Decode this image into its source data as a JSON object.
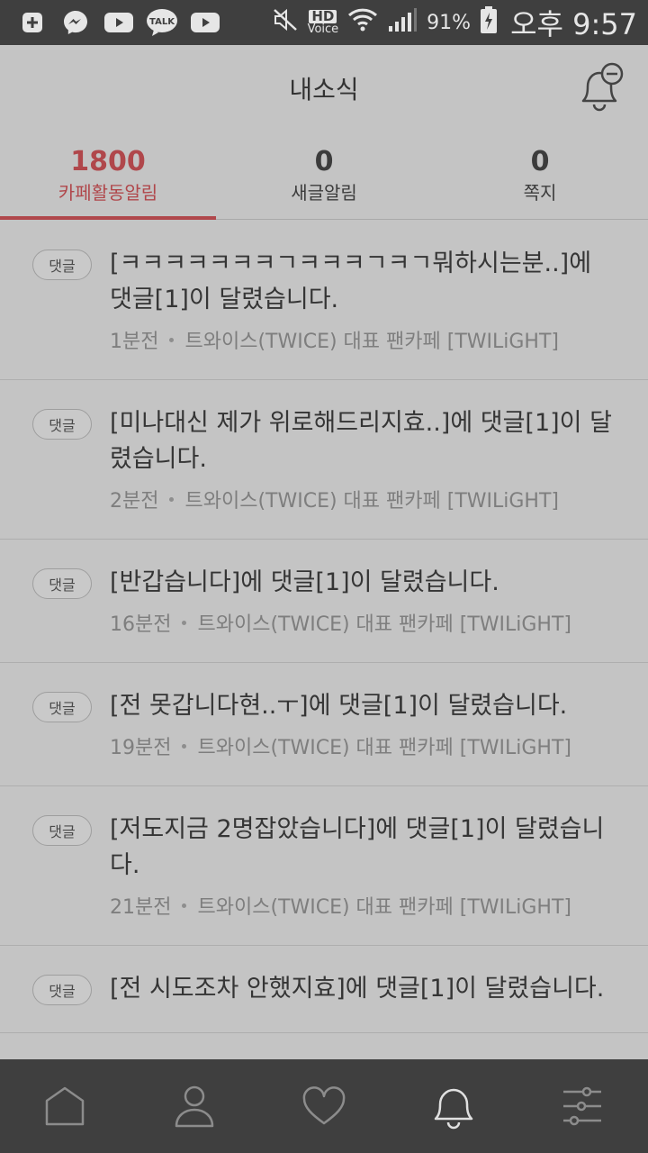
{
  "status_bar": {
    "apps": [
      "plus-square-icon",
      "messenger-icon",
      "youtube-icon",
      "kakaotalk-icon",
      "youtube-icon"
    ],
    "talk_label": "TALK",
    "hd_label": "HD",
    "voice_label": "Voice",
    "battery_percent": "91%",
    "time": "오후 9:57"
  },
  "header": {
    "title": "내소식"
  },
  "tabs": [
    {
      "count": "1800",
      "label": "카페활동알림",
      "active": true
    },
    {
      "count": "0",
      "label": "새글알림",
      "active": false
    },
    {
      "count": "0",
      "label": "쪽지",
      "active": false
    }
  ],
  "notifications": [
    {
      "badge": "댓글",
      "text": "[ㅋㅋㅋㅋㅋㅋㅋㄱㅋㅋㅋㄱㅋㄱ뭐하시는분..]에 댓글[1]이 달렸습니다.",
      "time": "1분전",
      "cafe": "트와이스(TWICE) 대표 팬카페 [TWILiGHT]"
    },
    {
      "badge": "댓글",
      "text": "[미나대신 제가 위로해드리지효..]에 댓글[1]이 달렸습니다.",
      "time": "2분전",
      "cafe": "트와이스(TWICE) 대표 팬카페 [TWILiGHT]"
    },
    {
      "badge": "댓글",
      "text": "[반갑습니다]에 댓글[1]이 달렸습니다.",
      "time": "16분전",
      "cafe": "트와이스(TWICE) 대표 팬카페 [TWILiGHT]"
    },
    {
      "badge": "댓글",
      "text": "[전 못갑니다현..ㅜ]에 댓글[1]이 달렸습니다.",
      "time": "19분전",
      "cafe": "트와이스(TWICE) 대표 팬카페 [TWILiGHT]"
    },
    {
      "badge": "댓글",
      "text": "[저도지금 2명잡았습니다]에 댓글[1]이 달렸습니다.",
      "time": "21분전",
      "cafe": "트와이스(TWICE) 대표 팬카페 [TWILiGHT]"
    },
    {
      "badge": "댓글",
      "text": "[전 시도조차 안했지효]에 댓글[1]이 달렸습니다.",
      "time": "",
      "cafe": ""
    }
  ],
  "bottom_nav": [
    {
      "icon": "home-icon",
      "active": false
    },
    {
      "icon": "profile-icon",
      "active": false
    },
    {
      "icon": "heart-icon",
      "active": false
    },
    {
      "icon": "bell-icon",
      "active": true
    },
    {
      "icon": "settings-sliders-icon",
      "active": false
    }
  ]
}
